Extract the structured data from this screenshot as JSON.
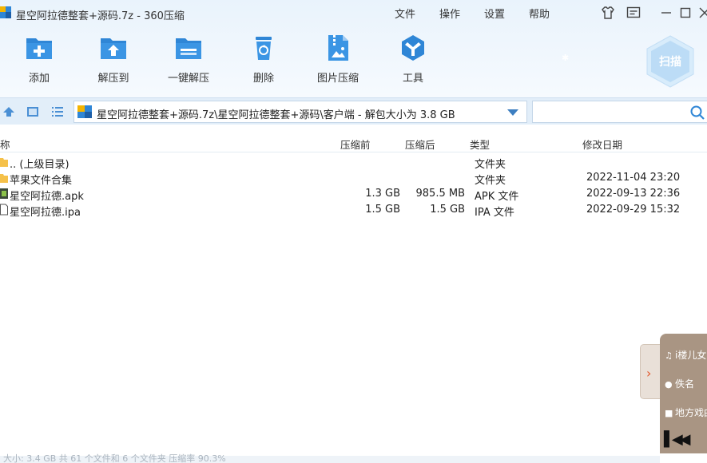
{
  "window": {
    "title": "星空阿拉德整套+源码.7z - 360压缩",
    "menu": [
      "文件",
      "操作",
      "设置",
      "帮助"
    ],
    "icons": [
      "app-logo-icon",
      "skin-shirt-icon",
      "message-icon",
      "minimize-icon",
      "maximize-icon",
      "close-icon"
    ]
  },
  "toolbar": {
    "items": [
      {
        "label": "添加",
        "icon": "add-icon"
      },
      {
        "label": "解压到",
        "icon": "extract-to-icon"
      },
      {
        "label": "一键解压",
        "icon": "one-click-extract-icon"
      },
      {
        "label": "删除",
        "icon": "delete-icon"
      },
      {
        "label": "图片压缩",
        "icon": "image-compress-icon"
      },
      {
        "label": "工具",
        "icon": "tools-icon"
      }
    ],
    "scan_label": "扫描"
  },
  "address": {
    "path": "星空阿拉德整套+源码.7z\\星空阿拉德整套+源码\\客户端 - 解包大小为 3.8 GB",
    "search_value": "",
    "search_placeholder": ""
  },
  "table": {
    "columns": [
      "称",
      "压缩前",
      "压缩后",
      "类型",
      "修改日期"
    ],
    "rows": [
      {
        "name": ".. (上级目录)",
        "size": "",
        "packed": "",
        "type": "文件夹",
        "date": "",
        "icon": "folder-icon"
      },
      {
        "name": "苹果文件合集",
        "size": "",
        "packed": "",
        "type": "文件夹",
        "date": "2022-11-04 23:20",
        "icon": "folder-icon"
      },
      {
        "name": "星空阿拉德.apk",
        "size": "1.3 GB",
        "packed": "985.5 MB",
        "type": "APK 文件",
        "date": "2022-09-13 22:36",
        "icon": "apk-file-icon"
      },
      {
        "name": "星空阿拉德.ipa",
        "size": "1.5 GB",
        "packed": "1.5 GB",
        "type": "IPA 文件",
        "date": "2022-09-29 15:32",
        "icon": "ipa-file-icon"
      }
    ]
  },
  "status": {
    "text": "大小: 3.4 GB 共 61 个文件和 6 个文件夹 压缩率 90.3%"
  },
  "music_panel": {
    "song": "i楼儿女",
    "artist": "佚名",
    "album": "地方戏曲"
  },
  "colors": {
    "accent": "#2f86d6",
    "header_bg": "#eaf3fc",
    "panel_bg": "#a99583"
  }
}
